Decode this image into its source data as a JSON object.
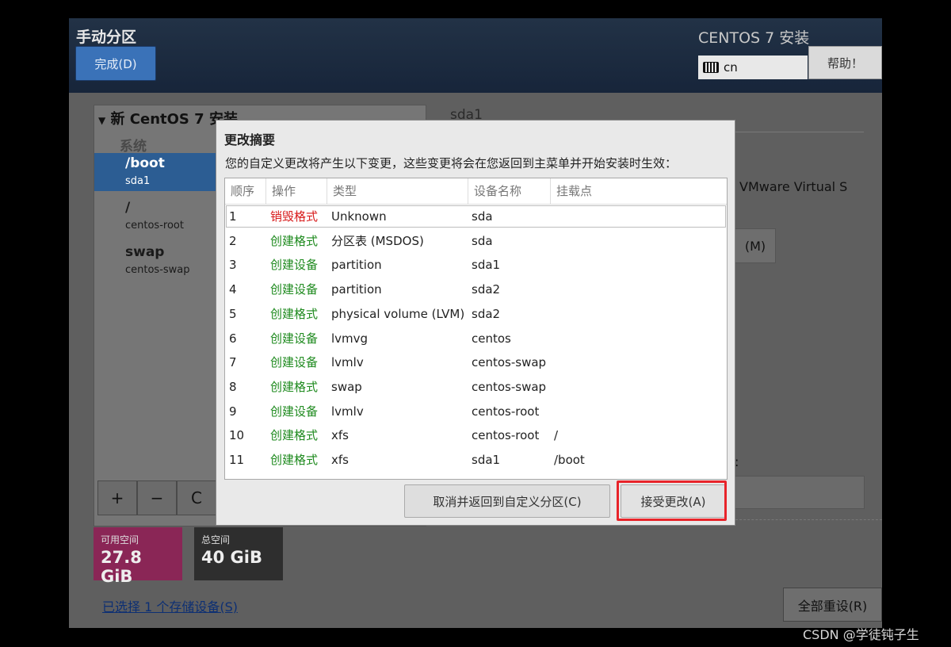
{
  "header": {
    "title": "手动分区",
    "done_label": "完成(D)",
    "product_title": "CENTOS 7 安装",
    "keyboard_layout": "cn",
    "help_label": "帮助！"
  },
  "left_panel": {
    "install_title": "新 CentOS 7 安装",
    "category": "系统",
    "mount_points": [
      {
        "name": "/boot",
        "device": "sda1",
        "selected": true
      },
      {
        "name": "/",
        "device": "centos-root",
        "selected": false
      },
      {
        "name": "swap",
        "device": "centos-swap",
        "selected": false
      }
    ],
    "toolbar": {
      "add": "+",
      "remove": "−",
      "refresh": "C"
    }
  },
  "right_panel": {
    "device_label": "sda1",
    "device_desc": "VMware Virtual S",
    "modify_label": "(M)",
    "colon": ":"
  },
  "space": {
    "available_label": "可用空间",
    "available_value": "27.8 GiB",
    "total_label": "总空间",
    "total_value": "40 GiB",
    "available_color": "#8a2656",
    "total_color": "#2e2e2e"
  },
  "footer": {
    "storage_link": "已选择 1 个存储设备(S)",
    "reset_label": "全部重设(R)"
  },
  "dialog": {
    "title": "更改摘要",
    "description": "您的自定义更改将产生以下变更，这些变更将会在您返回到主菜单并开始安装时生效：",
    "columns": [
      "顺序",
      "操作",
      "类型",
      "设备名称",
      "挂载点"
    ],
    "rows": [
      {
        "order": "1",
        "action": "销毁格式",
        "type": "Unknown",
        "device": "sda",
        "mount": "",
        "destructive": true
      },
      {
        "order": "2",
        "action": "创建格式",
        "type": "分区表 (MSDOS)",
        "device": "sda",
        "mount": "",
        "destructive": false
      },
      {
        "order": "3",
        "action": "创建设备",
        "type": "partition",
        "device": "sda1",
        "mount": "",
        "destructive": false
      },
      {
        "order": "4",
        "action": "创建设备",
        "type": "partition",
        "device": "sda2",
        "mount": "",
        "destructive": false
      },
      {
        "order": "5",
        "action": "创建格式",
        "type": "physical volume (LVM)",
        "device": "sda2",
        "mount": "",
        "destructive": false
      },
      {
        "order": "6",
        "action": "创建设备",
        "type": "lvmvg",
        "device": "centos",
        "mount": "",
        "destructive": false
      },
      {
        "order": "7",
        "action": "创建设备",
        "type": "lvmlv",
        "device": "centos-swap",
        "mount": "",
        "destructive": false
      },
      {
        "order": "8",
        "action": "创建格式",
        "type": "swap",
        "device": "centos-swap",
        "mount": "",
        "destructive": false
      },
      {
        "order": "9",
        "action": "创建设备",
        "type": "lvmlv",
        "device": "centos-root",
        "mount": "",
        "destructive": false
      },
      {
        "order": "10",
        "action": "创建格式",
        "type": "xfs",
        "device": "centos-root",
        "mount": "/",
        "destructive": false
      },
      {
        "order": "11",
        "action": "创建格式",
        "type": "xfs",
        "device": "sda1",
        "mount": "/boot",
        "destructive": false
      }
    ],
    "cancel_label": "取消并返回到自定义分区(C)",
    "accept_label": "接受更改(A)",
    "destroy_color": "#d81b1b",
    "create_color": "#1e8a1e",
    "highlight_color": "#e8242a"
  },
  "watermark": "CSDN @学徒钝子生"
}
